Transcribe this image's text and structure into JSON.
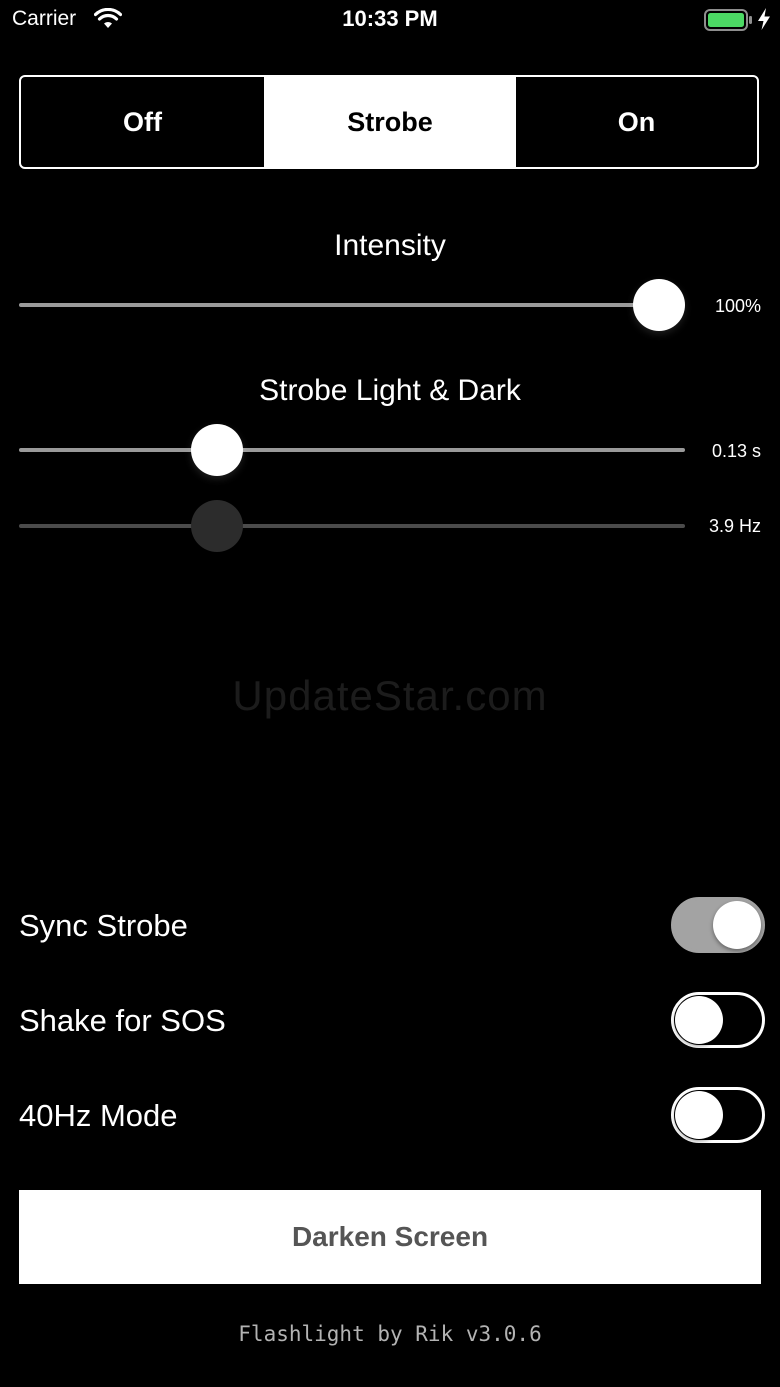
{
  "status_bar": {
    "carrier": "Carrier",
    "time": "10:33 PM",
    "battery_level": 1.0,
    "battery_color": "#4cd964",
    "charging": true
  },
  "mode_control": {
    "segments": [
      "Off",
      "Strobe",
      "On"
    ],
    "selected": "Strobe"
  },
  "intensity": {
    "title": "Intensity",
    "value_fraction": 1.0,
    "value_label": "100%"
  },
  "strobe": {
    "title": "Strobe Light & Dark",
    "period_fraction": 0.28,
    "period_label": "0.13 s",
    "frequency_fraction": 0.28,
    "frequency_label": "3.9 Hz"
  },
  "watermark": "UpdateStar.com",
  "toggles": [
    {
      "label": "Sync Strobe",
      "on": true
    },
    {
      "label": "Shake for SOS",
      "on": false
    },
    {
      "label": "40Hz Mode",
      "on": false
    }
  ],
  "darken_button": "Darken Screen",
  "footer": "Flashlight by Rik v3.0.6",
  "colors": {
    "background": "#000000",
    "foreground": "#ffffff",
    "switch_on_track": "#a3a3a3"
  }
}
